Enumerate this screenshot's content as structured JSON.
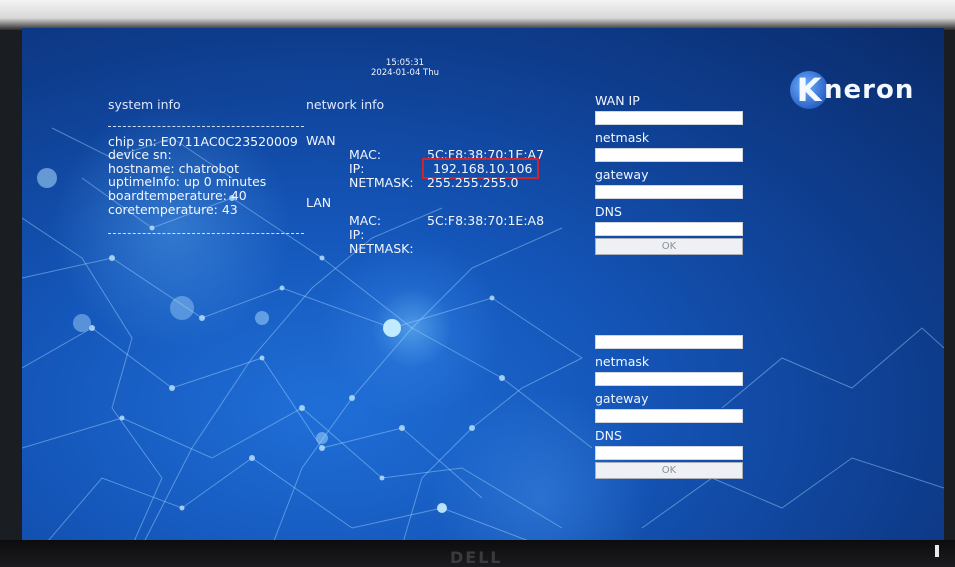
{
  "clock": {
    "time": "15:05:31",
    "date": "2024-01-04 Thu"
  },
  "brand": {
    "logo_letter": "K",
    "logo_word": "neron"
  },
  "system_info": {
    "heading": "system info",
    "lines": [
      "chip sn: E0711AC0C23520009",
      "device sn:",
      "hostname: chatrobot",
      "uptimeInfo: up 0 minutes",
      "boardtemperature: 40",
      "coretemperature: 43"
    ]
  },
  "network_info": {
    "heading": "network info",
    "wan": {
      "label": "WAN",
      "mac_label": "MAC:",
      "mac": "5C:F8:38:70:1E:A7",
      "ip_label": "IP:",
      "ip": "192.168.10.106",
      "netmask_label": "NETMASK:",
      "netmask": "255.255.255.0"
    },
    "lan": {
      "label": "LAN",
      "mac_label": "MAC:",
      "mac": "5C:F8:38:70:1E:A8",
      "ip_label": "IP:",
      "ip": "",
      "netmask_label": "NETMASK:",
      "netmask": ""
    }
  },
  "wan_form": {
    "ip_label": "WAN IP",
    "netmask_label": "netmask",
    "gateway_label": "gateway",
    "dns_label": "DNS",
    "ok_label": "OK"
  },
  "lan_form": {
    "netmask_label": "netmask",
    "gateway_label": "gateway",
    "dns_label": "DNS",
    "ok_label": "OK"
  },
  "monitor": {
    "brand": "DELL"
  },
  "colors": {
    "highlight": "#d0242a",
    "background": "#1455b8"
  }
}
